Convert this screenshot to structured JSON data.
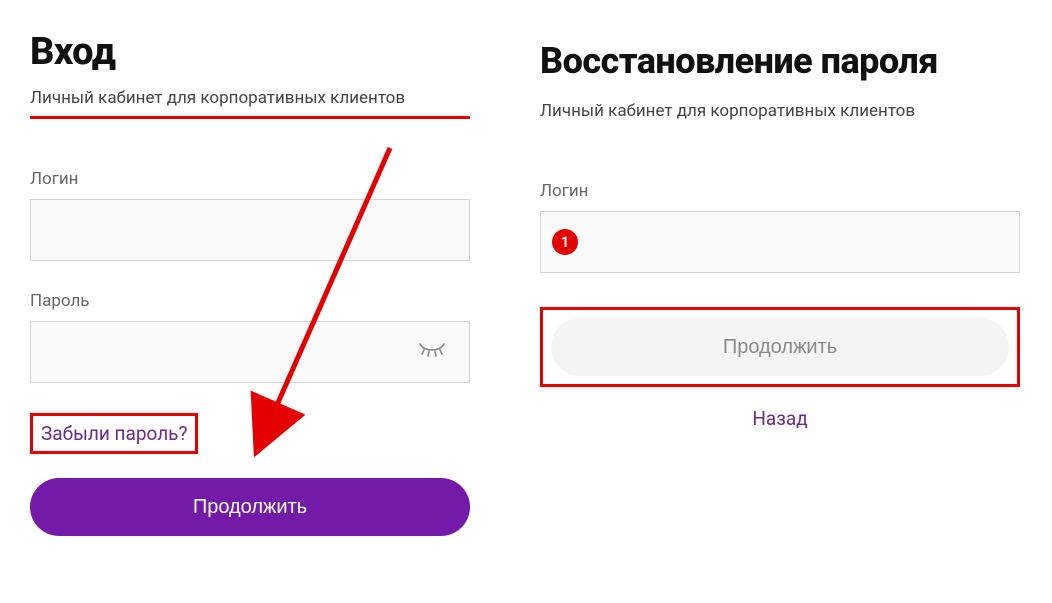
{
  "login": {
    "title": "Вход",
    "subtitle": "Личный кабинет для корпоративных клиентов",
    "username_label": "Логин",
    "password_label": "Пароль",
    "forgot_label": "Забыли пароль?",
    "continue_label": "Продолжить"
  },
  "recover": {
    "title": "Восстановление пароля",
    "subtitle": "Личный кабинет для корпоративных клиентов",
    "username_label": "Логин",
    "badge": "1",
    "continue_label": "Продолжить",
    "back_label": "Назад"
  },
  "colors": {
    "annotation_red": "#e30000",
    "brand_purple": "#731ba8",
    "link_purple": "#6b2b8c"
  }
}
